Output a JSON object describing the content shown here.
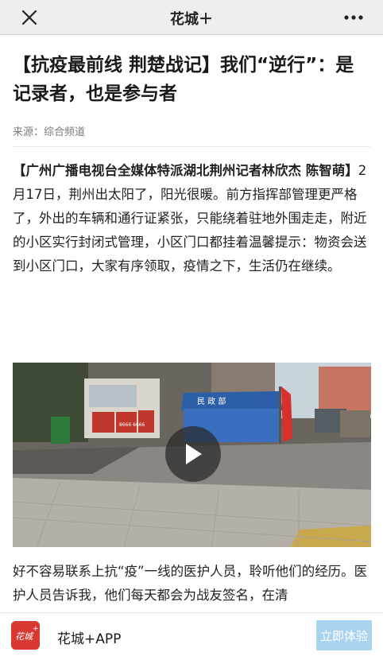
{
  "topbar": {
    "title": "花城＋",
    "close_icon": "close-icon",
    "more_icon": "more-icon"
  },
  "article": {
    "title": "【抗疫最前线 荆楚战记】我们“逆行”：是记录者，也是参与者",
    "source": "来源：综合频道",
    "byline": "【广州广播电视台全媒体特派湖北荆州记者林欣杰 陈智萌】",
    "paragraph1_body": "2月17日，荆州出太阳了，阳光很暖。前方指挥部管理更严格了，外出的车辆和通行证紧张，只能绕着驻地外围走走，附近的小区实行封闭式管理，小区门口都挂着温馨提示：物资会送到小区门口，大家有序领取，疫情之下，生活仍在继续。",
    "paragraph2": "好不容易联系上抗“疫”一线的医护人员，聆听他们的经历。医护人员告诉我，他们每天都会为战友签名，在清"
  },
  "video": {
    "play_icon": "play-icon",
    "tent_text": "民 政 部",
    "sign_text_left": "8666 6666"
  },
  "bottombar": {
    "app_name": "花城+APP",
    "logo_text": "花城",
    "open_button": "立即体验"
  },
  "colors": {
    "topbar_bg": "#eeeeee",
    "brand_red": "#d83a32",
    "open_button_bg": "#a9d3ee"
  }
}
